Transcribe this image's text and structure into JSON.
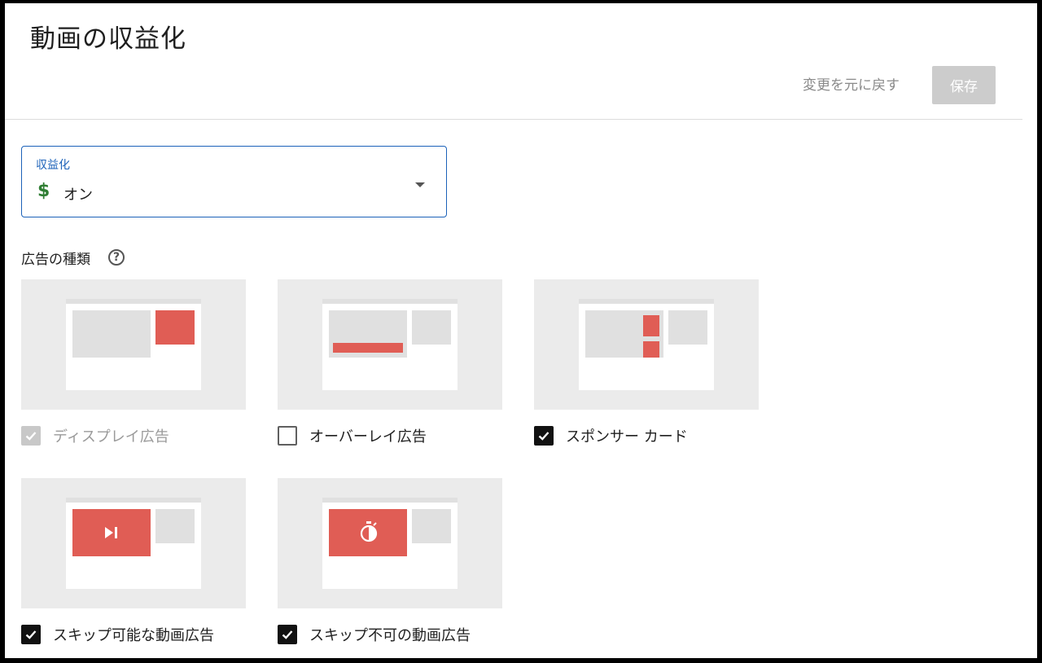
{
  "header": {
    "title": "動画の収益化",
    "revert_label": "変更を元に戻す",
    "save_label": "保存"
  },
  "monetization": {
    "label": "収益化",
    "icon": "dollar-icon",
    "icon_glyph": "$",
    "value": "オン"
  },
  "ad_types": {
    "heading": "広告の種類",
    "help_icon": "?",
    "items": [
      {
        "label": "ディスプレイ広告",
        "checked": true,
        "disabled": true
      },
      {
        "label": "オーバーレイ広告",
        "checked": false,
        "disabled": false
      },
      {
        "label": "スポンサー カード",
        "checked": true,
        "disabled": false
      },
      {
        "label": "スキップ可能な動画広告",
        "checked": true,
        "disabled": false
      },
      {
        "label": "スキップ不可の動画広告",
        "checked": true,
        "disabled": false
      }
    ]
  },
  "colors": {
    "accent": "#1c62b9",
    "ad_red": "#e05d55",
    "dollar_green": "#2e7d32",
    "disabled_button": "#cccccc"
  }
}
